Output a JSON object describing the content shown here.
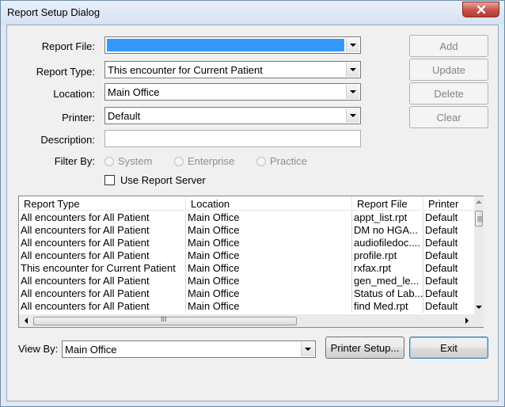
{
  "window": {
    "title": "Report Setup Dialog"
  },
  "form": {
    "report_file": {
      "label": "Report File:",
      "value": ""
    },
    "report_type": {
      "label": "Report Type:",
      "value": "This encounter for Current Patient"
    },
    "location": {
      "label": "Location:",
      "value": "Main Office"
    },
    "printer": {
      "label": "Printer:",
      "value": "Default"
    },
    "description": {
      "label": "Description:",
      "value": ""
    },
    "filter_by": {
      "label": "Filter By:",
      "options": [
        "System",
        "Enterprise",
        "Practice"
      ]
    },
    "use_report_server": {
      "label": "Use Report Server",
      "checked": false
    }
  },
  "actions": {
    "add": "Add",
    "update": "Update",
    "delete": "Delete",
    "clear": "Clear"
  },
  "table": {
    "columns": [
      "Report Type",
      "Location",
      "Report File",
      "Printer"
    ],
    "rows": [
      [
        "All encounters for All Patient",
        "Main Office",
        "appt_list.rpt",
        "Default"
      ],
      [
        "All encounters for All Patient",
        "Main Office",
        "DM no HGA...",
        "Default"
      ],
      [
        "All encounters for All Patient",
        "Main Office",
        "audiofiledoc....",
        "Default"
      ],
      [
        "All encounters for All Patient",
        "Main Office",
        "profile.rpt",
        "Default"
      ],
      [
        "This encounter for Current Patient",
        "Main Office",
        "rxfax.rpt",
        "Default"
      ],
      [
        "All encounters for All Patient",
        "Main Office",
        "gen_med_le...",
        "Default"
      ],
      [
        "All encounters for All Patient",
        "Main Office",
        "Status of Lab...",
        "Default"
      ],
      [
        "All encounters for All Patient",
        "Main Office",
        "find Med.rpt",
        "Default"
      ]
    ],
    "hscroll_grip": "III"
  },
  "footer": {
    "view_by": {
      "label": "View By:",
      "value": "Main Office"
    },
    "printer_setup": "Printer Setup...",
    "exit": "Exit"
  },
  "colors": {
    "selection": "#3399ff",
    "close": "#c75050"
  }
}
